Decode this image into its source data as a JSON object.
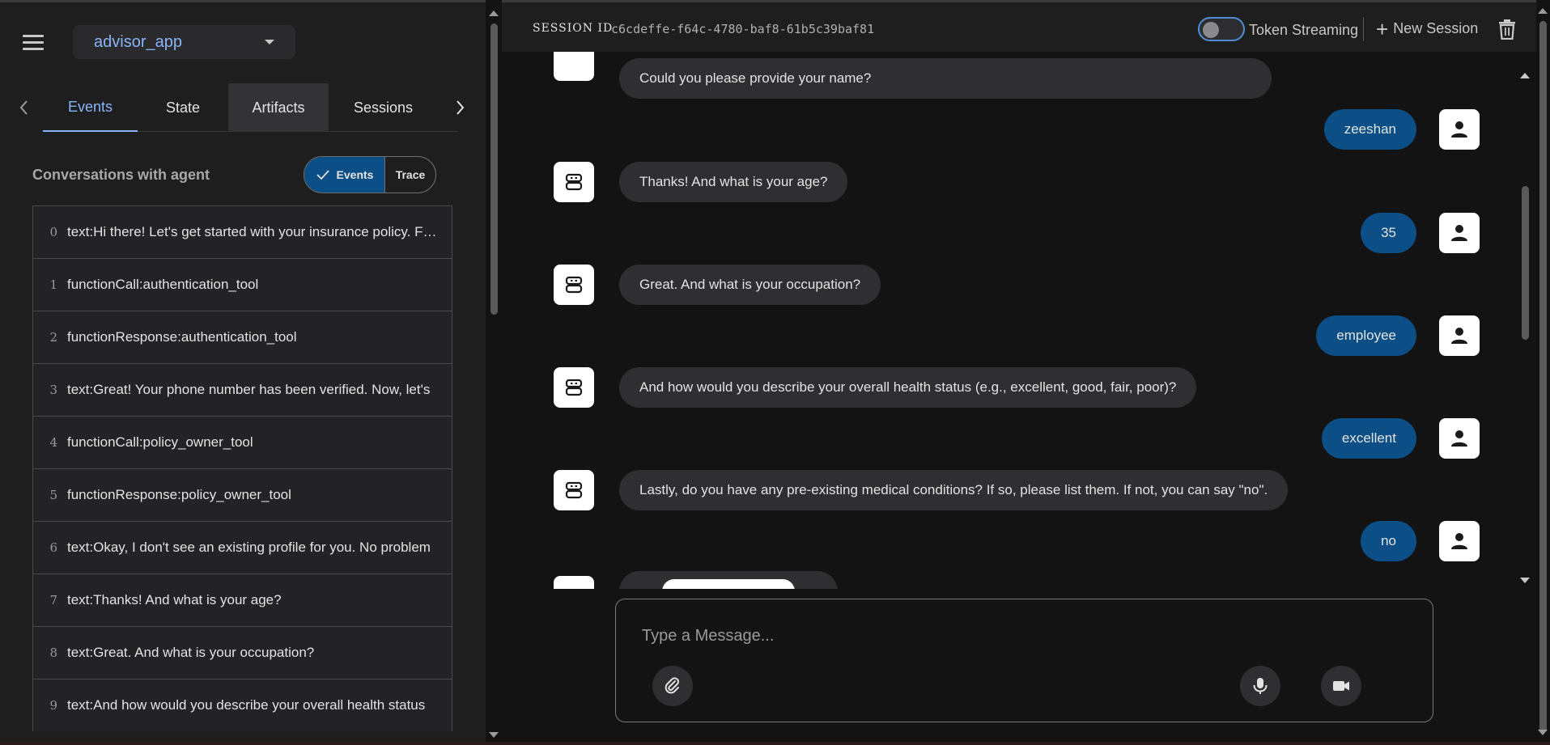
{
  "app_select": {
    "value": "advisor_app"
  },
  "tabs": [
    {
      "label": "Events"
    },
    {
      "label": "State"
    },
    {
      "label": "Artifacts"
    },
    {
      "label": "Sessions"
    }
  ],
  "conversations": {
    "label": "Conversations with agent",
    "toggle": {
      "events_label": "Events",
      "trace_label": "Trace"
    }
  },
  "events": [
    {
      "index": "0",
      "text": "text:Hi there! Let's get started with your insurance policy. First, could you"
    },
    {
      "index": "1",
      "text": "functionCall:authentication_tool"
    },
    {
      "index": "2",
      "text": "functionResponse:authentication_tool"
    },
    {
      "index": "3",
      "text": "text:Great! Your phone number has been verified. Now, let's"
    },
    {
      "index": "4",
      "text": "functionCall:policy_owner_tool"
    },
    {
      "index": "5",
      "text": "functionResponse:policy_owner_tool"
    },
    {
      "index": "6",
      "text": "text:Okay, I don't see an existing profile for you. No problem"
    },
    {
      "index": "7",
      "text": "text:Thanks! And what is your age?"
    },
    {
      "index": "8",
      "text": "text:Great. And what is your occupation?"
    },
    {
      "index": "9",
      "text": "text:And how would you describe your overall health status"
    }
  ],
  "session": {
    "label": "SESSION ID",
    "id": "c6cdeffe-f64c-4780-baf8-61b5c39baf81",
    "token_streaming_label": "Token Streaming",
    "new_session_label": "New Session"
  },
  "messages": [
    {
      "role": "bot",
      "text": "Could you please provide your name?"
    },
    {
      "role": "user",
      "text": "zeeshan"
    },
    {
      "role": "bot",
      "text": "Thanks! And what is your age?"
    },
    {
      "role": "user",
      "text": "35"
    },
    {
      "role": "bot",
      "text": "Great. And what is your occupation?"
    },
    {
      "role": "user",
      "text": "employee"
    },
    {
      "role": "bot",
      "text": "And how would you describe your overall health status (e.g., excellent, good, fair, poor)?"
    },
    {
      "role": "user",
      "text": "excellent"
    },
    {
      "role": "bot",
      "text": "Lastly, do you have any pre-existing medical conditions? If so, please list them. If not, you can say \"no\"."
    },
    {
      "role": "user",
      "text": "no"
    }
  ],
  "composer": {
    "placeholder": "Type a Message..."
  },
  "icons": {
    "menu": "menu-icon",
    "dropdown": "chevron-down-icon",
    "check": "check-icon",
    "trash": "trash-icon",
    "attach": "paperclip-icon",
    "mic": "microphone-icon",
    "camera": "video-camera-icon",
    "bot": "robot-icon",
    "user": "person-icon"
  },
  "colors": {
    "accent": "#8ab4f8",
    "user_bubble": "#0b4f86",
    "bot_bubble": "#2f2f31"
  }
}
